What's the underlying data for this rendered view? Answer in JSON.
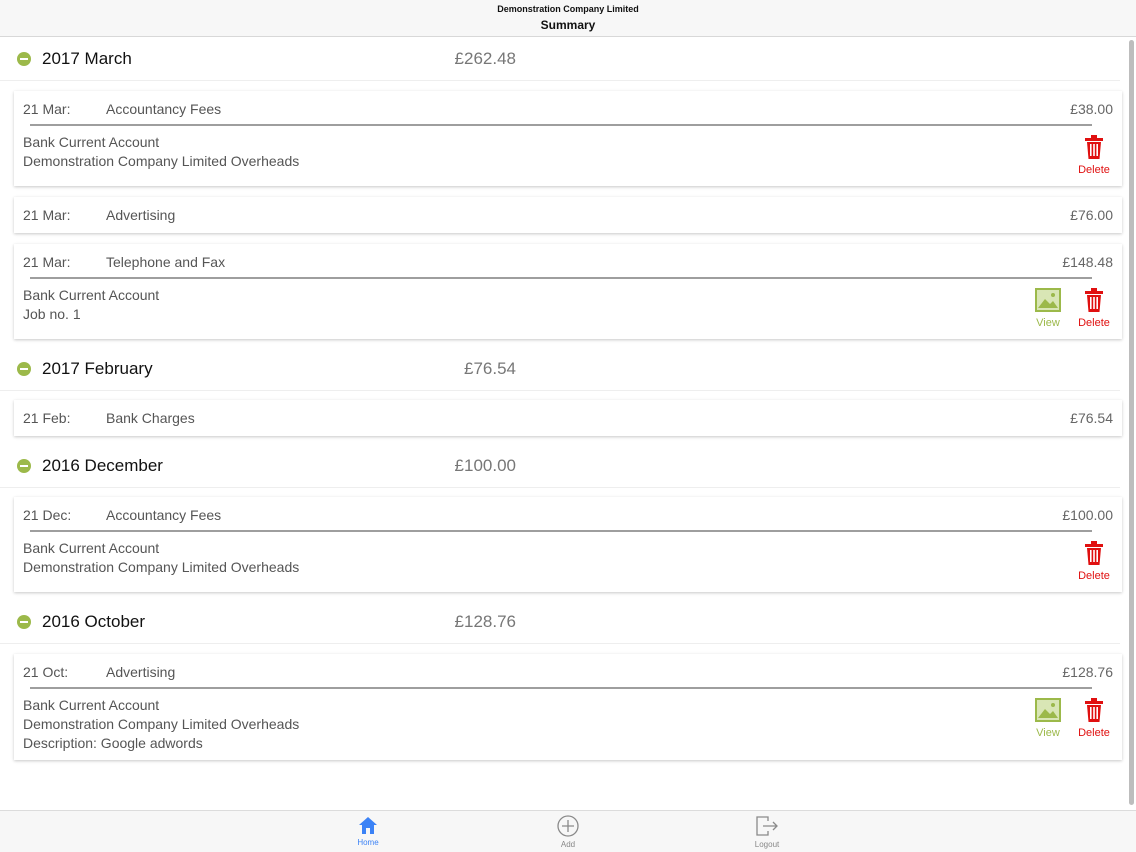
{
  "header": {
    "company": "Demonstration Company Limited",
    "title": "Summary"
  },
  "months": [
    {
      "name": "2017 March",
      "total": "£262.48"
    },
    {
      "name": "2017 February",
      "total": "£76.54"
    },
    {
      "name": "2016 December",
      "total": "£100.00"
    },
    {
      "name": "2016 October",
      "total": "£128.76"
    }
  ],
  "entries": [
    {
      "date": "21 Mar:",
      "description": "Accountancy Fees",
      "amount": "£38.00",
      "lines": [
        "Bank Current Account",
        "Demonstration Company Limited Overheads"
      ]
    },
    {
      "date": "21 Mar:",
      "description": "Advertising",
      "amount": "£76.00"
    },
    {
      "date": "21 Mar:",
      "description": "Telephone and Fax",
      "amount": "£148.48",
      "lines": [
        "Bank Current Account",
        "Job no. 1"
      ]
    },
    {
      "date": "21 Feb:",
      "description": "Bank Charges",
      "amount": "£76.54"
    },
    {
      "date": "21 Dec:",
      "description": "Accountancy Fees",
      "amount": "£100.00",
      "lines": [
        "Bank Current Account",
        "Demonstration Company Limited Overheads"
      ]
    },
    {
      "date": "21 Oct:",
      "description": "Advertising",
      "amount": "£128.76",
      "lines": [
        "Bank Current Account",
        "Demonstration Company Limited Overheads",
        "Description: Google adwords"
      ]
    }
  ],
  "actions": {
    "view_label": "View",
    "delete_label": "Delete"
  },
  "tabs": [
    {
      "label": "Home",
      "icon": "home-icon",
      "active": true
    },
    {
      "label": "Add",
      "icon": "plus-circle-icon"
    },
    {
      "label": "Logout",
      "icon": "logout-icon"
    }
  ],
  "colors": {
    "accent_green": "#9cb94a",
    "delete_red": "#e01010",
    "active_tab_blue": "#3b82f6"
  }
}
